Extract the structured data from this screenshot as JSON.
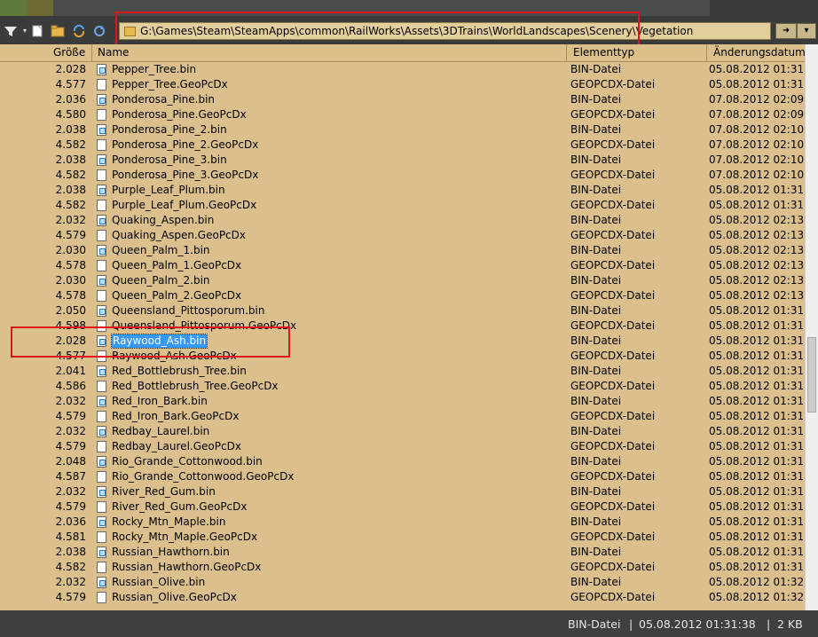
{
  "address": {
    "path": "G:\\Games\\Steam\\SteamApps\\common\\RailWorks\\Assets\\3DTrains\\WorldLandscapes\\Scenery\\Vegetation"
  },
  "toolbar": {
    "filter_icon": "filter-icon",
    "new_file_icon": "new-file-icon",
    "new_folder_icon": "new-folder-icon",
    "sync_icon": "sync-icon",
    "refresh_icon": "refresh-icon",
    "go_icon": "go-arrow-icon",
    "dropdown_icon": "chevron-down-icon"
  },
  "columns": {
    "size": "Größe",
    "name": "Name",
    "type": "Elementtyp",
    "date": "Änderungsdatum"
  },
  "files": [
    {
      "size": "2.028",
      "name": "Pepper_Tree.bin",
      "type": "BIN-Datei",
      "date": "05.08.2012 01:31"
    },
    {
      "size": "4.577",
      "name": "Pepper_Tree.GeoPcDx",
      "type": "GEOPCDX-Datei",
      "date": "05.08.2012 01:31"
    },
    {
      "size": "2.036",
      "name": "Ponderosa_Pine.bin",
      "type": "BIN-Datei",
      "date": "07.08.2012 02:09"
    },
    {
      "size": "4.580",
      "name": "Ponderosa_Pine.GeoPcDx",
      "type": "GEOPCDX-Datei",
      "date": "07.08.2012 02:09"
    },
    {
      "size": "2.038",
      "name": "Ponderosa_Pine_2.bin",
      "type": "BIN-Datei",
      "date": "07.08.2012 02:10"
    },
    {
      "size": "4.582",
      "name": "Ponderosa_Pine_2.GeoPcDx",
      "type": "GEOPCDX-Datei",
      "date": "07.08.2012 02:10"
    },
    {
      "size": "2.038",
      "name": "Ponderosa_Pine_3.bin",
      "type": "BIN-Datei",
      "date": "07.08.2012 02:10"
    },
    {
      "size": "4.582",
      "name": "Ponderosa_Pine_3.GeoPcDx",
      "type": "GEOPCDX-Datei",
      "date": "07.08.2012 02:10"
    },
    {
      "size": "2.038",
      "name": "Purple_Leaf_Plum.bin",
      "type": "BIN-Datei",
      "date": "05.08.2012 01:31"
    },
    {
      "size": "4.582",
      "name": "Purple_Leaf_Plum.GeoPcDx",
      "type": "GEOPCDX-Datei",
      "date": "05.08.2012 01:31"
    },
    {
      "size": "2.032",
      "name": "Quaking_Aspen.bin",
      "type": "BIN-Datei",
      "date": "05.08.2012 02:13"
    },
    {
      "size": "4.579",
      "name": "Quaking_Aspen.GeoPcDx",
      "type": "GEOPCDX-Datei",
      "date": "05.08.2012 02:13"
    },
    {
      "size": "2.030",
      "name": "Queen_Palm_1.bin",
      "type": "BIN-Datei",
      "date": "05.08.2012 02:13"
    },
    {
      "size": "4.578",
      "name": "Queen_Palm_1.GeoPcDx",
      "type": "GEOPCDX-Datei",
      "date": "05.08.2012 02:13"
    },
    {
      "size": "2.030",
      "name": "Queen_Palm_2.bin",
      "type": "BIN-Datei",
      "date": "05.08.2012 02:13"
    },
    {
      "size": "4.578",
      "name": "Queen_Palm_2.GeoPcDx",
      "type": "GEOPCDX-Datei",
      "date": "05.08.2012 02:13"
    },
    {
      "size": "2.050",
      "name": "Queensland_Pittosporum.bin",
      "type": "BIN-Datei",
      "date": "05.08.2012 01:31"
    },
    {
      "size": "4.598",
      "name": "Queensland_Pittosporum.GeoPcDx",
      "type": "GEOPCDX-Datei",
      "date": "05.08.2012 01:31"
    },
    {
      "size": "2.028",
      "name": "Raywood_Ash.bin",
      "type": "BIN-Datei",
      "date": "05.08.2012 01:31"
    },
    {
      "size": "4.577",
      "name": "Raywood_Ash.GeoPcDx",
      "type": "GEOPCDX-Datei",
      "date": "05.08.2012 01:31"
    },
    {
      "size": "2.041",
      "name": "Red_Bottlebrush_Tree.bin",
      "type": "BIN-Datei",
      "date": "05.08.2012 01:31"
    },
    {
      "size": "4.586",
      "name": "Red_Bottlebrush_Tree.GeoPcDx",
      "type": "GEOPCDX-Datei",
      "date": "05.08.2012 01:31"
    },
    {
      "size": "2.032",
      "name": "Red_Iron_Bark.bin",
      "type": "BIN-Datei",
      "date": "05.08.2012 01:31"
    },
    {
      "size": "4.579",
      "name": "Red_Iron_Bark.GeoPcDx",
      "type": "GEOPCDX-Datei",
      "date": "05.08.2012 01:31"
    },
    {
      "size": "2.032",
      "name": "Redbay_Laurel.bin",
      "type": "BIN-Datei",
      "date": "05.08.2012 01:31"
    },
    {
      "size": "4.579",
      "name": "Redbay_Laurel.GeoPcDx",
      "type": "GEOPCDX-Datei",
      "date": "05.08.2012 01:31"
    },
    {
      "size": "2.048",
      "name": "Rio_Grande_Cottonwood.bin",
      "type": "BIN-Datei",
      "date": "05.08.2012 01:31"
    },
    {
      "size": "4.587",
      "name": "Rio_Grande_Cottonwood.GeoPcDx",
      "type": "GEOPCDX-Datei",
      "date": "05.08.2012 01:31"
    },
    {
      "size": "2.032",
      "name": "River_Red_Gum.bin",
      "type": "BIN-Datei",
      "date": "05.08.2012 01:31"
    },
    {
      "size": "4.579",
      "name": "River_Red_Gum.GeoPcDx",
      "type": "GEOPCDX-Datei",
      "date": "05.08.2012 01:31"
    },
    {
      "size": "2.036",
      "name": "Rocky_Mtn_Maple.bin",
      "type": "BIN-Datei",
      "date": "05.08.2012 01:31"
    },
    {
      "size": "4.581",
      "name": "Rocky_Mtn_Maple.GeoPcDx",
      "type": "GEOPCDX-Datei",
      "date": "05.08.2012 01:31"
    },
    {
      "size": "2.038",
      "name": "Russian_Hawthorn.bin",
      "type": "BIN-Datei",
      "date": "05.08.2012 01:31"
    },
    {
      "size": "4.582",
      "name": "Russian_Hawthorn.GeoPcDx",
      "type": "GEOPCDX-Datei",
      "date": "05.08.2012 01:31"
    },
    {
      "size": "2.032",
      "name": "Russian_Olive.bin",
      "type": "BIN-Datei",
      "date": "05.08.2012 01:32"
    },
    {
      "size": "4.579",
      "name": "Russian_Olive.GeoPcDx",
      "type": "GEOPCDX-Datei",
      "date": "05.08.2012 01:32"
    }
  ],
  "selected_index": 18,
  "status": {
    "type": "BIN-Datei",
    "sep1": "|",
    "date": "05.08.2012 01:31:38",
    "sep2": "|",
    "size": "2 KB"
  },
  "colors": {
    "list_background": "#dbbf8c",
    "selection": "#3399ff",
    "annotation_red": "#e0141c"
  }
}
